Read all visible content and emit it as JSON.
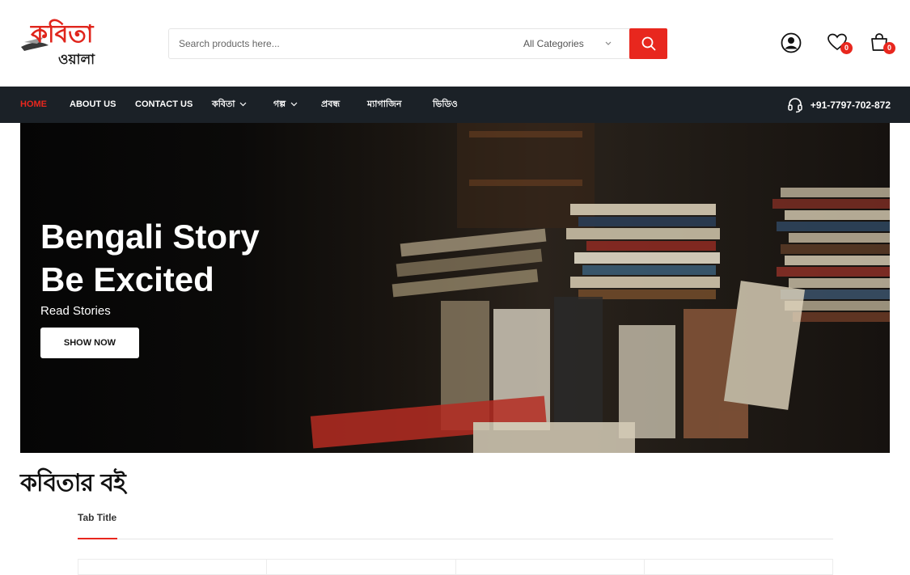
{
  "logo": {
    "line1": "কবিতা",
    "line2": "ওয়ালা"
  },
  "search": {
    "placeholder": "Search products here...",
    "category": "All Categories"
  },
  "header_icons": {
    "wishlist_count": "0",
    "cart_count": "0"
  },
  "nav": {
    "items": [
      {
        "label": "HOME",
        "active": true
      },
      {
        "label": "ABOUT US"
      },
      {
        "label": "CONTACT US"
      },
      {
        "label": "কবিতা",
        "dropdown": true
      },
      {
        "label": "গল্প",
        "dropdown": true
      },
      {
        "label": "প্রবন্ধ"
      },
      {
        "label": "ম্যাগাজিন"
      },
      {
        "label": "ভিডিও"
      }
    ],
    "phone": "+91-7797-702-872"
  },
  "hero": {
    "title_line1": "Bengali Story",
    "title_line2": "Be Excited",
    "subtitle": "Read Stories",
    "button": "SHOW NOW"
  },
  "section": {
    "title": "কবিতার বই",
    "tab": "Tab Title"
  },
  "colors": {
    "accent": "#e8271e",
    "nav_bg": "#1b2127"
  }
}
